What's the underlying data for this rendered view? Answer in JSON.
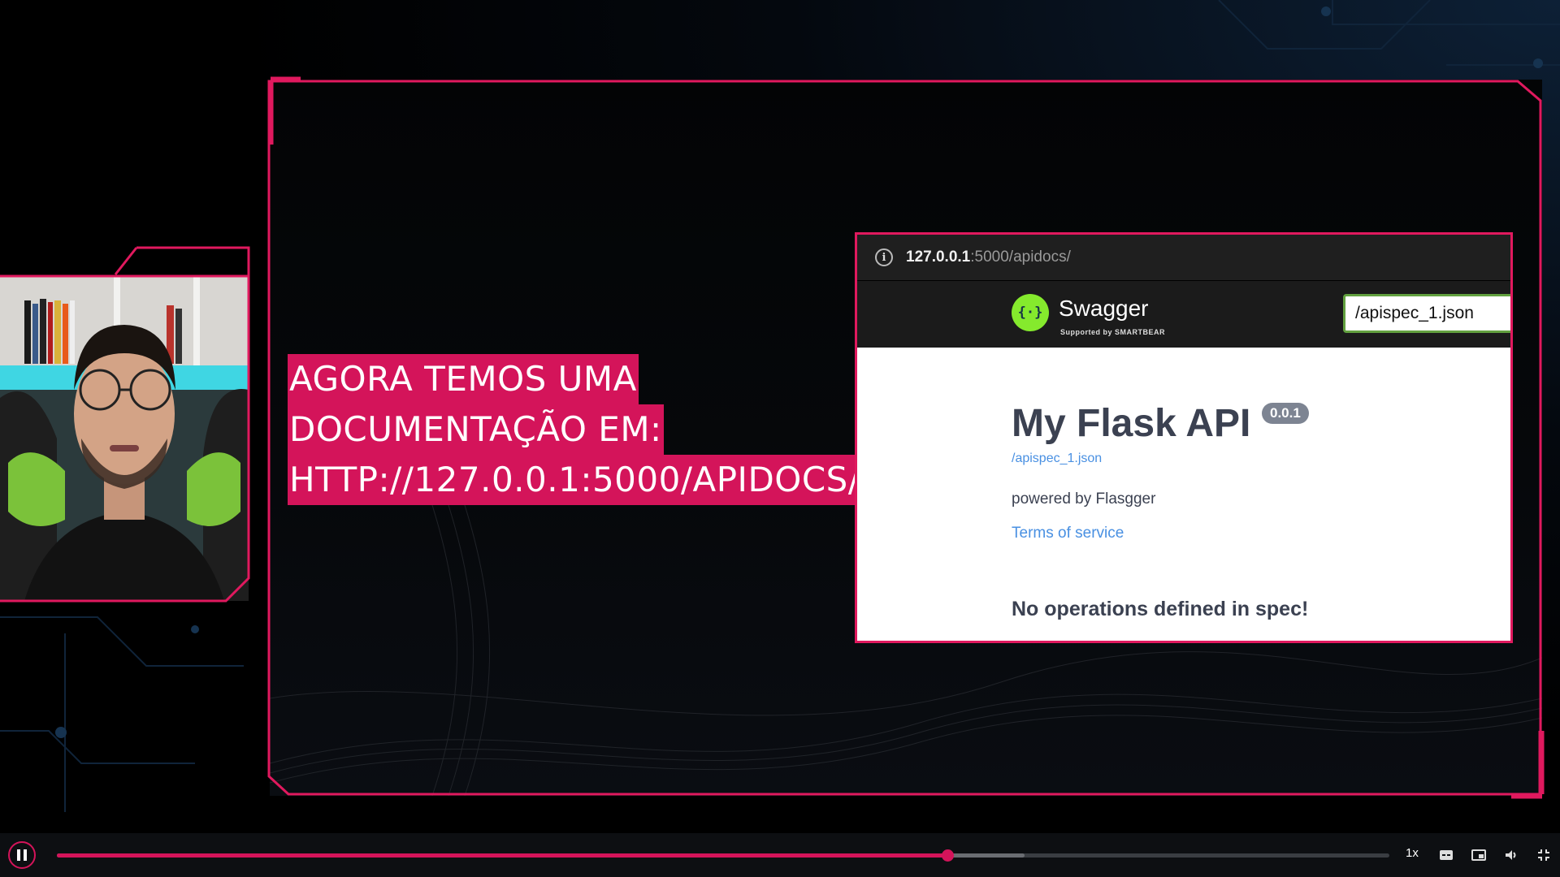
{
  "caption": {
    "lines": [
      "AGORA TEMOS UMA",
      "DOCUMENTAÇÃO EM:",
      "HTTP://127.0.0.1:5000/APIDOCS/"
    ]
  },
  "browser": {
    "url_host": "127.0.0.1",
    "url_path": ":5000/apidocs/",
    "swagger_name": "Swagger",
    "swagger_sub": "Supported by SMARTBEAR",
    "spec_input_value": "/apispec_1.json",
    "api_title": "My Flask API",
    "version": "0.0.1",
    "spec_link": "/apispec_1.json",
    "powered_by": "powered by Flasgger",
    "terms": "Terms of service",
    "no_operations": "No operations defined in spec!"
  },
  "player": {
    "progress_fraction": 0.668,
    "buffered_fraction": 0.726,
    "speed_label": "1x",
    "icons": [
      "pause-icon",
      "subtitles-icon",
      "picture-in-picture-icon",
      "volume-icon",
      "exit-fullscreen-icon"
    ]
  },
  "colors": {
    "accent": "#d4145a",
    "frame": "#e0195e",
    "swagger_green": "#85ea2d"
  }
}
